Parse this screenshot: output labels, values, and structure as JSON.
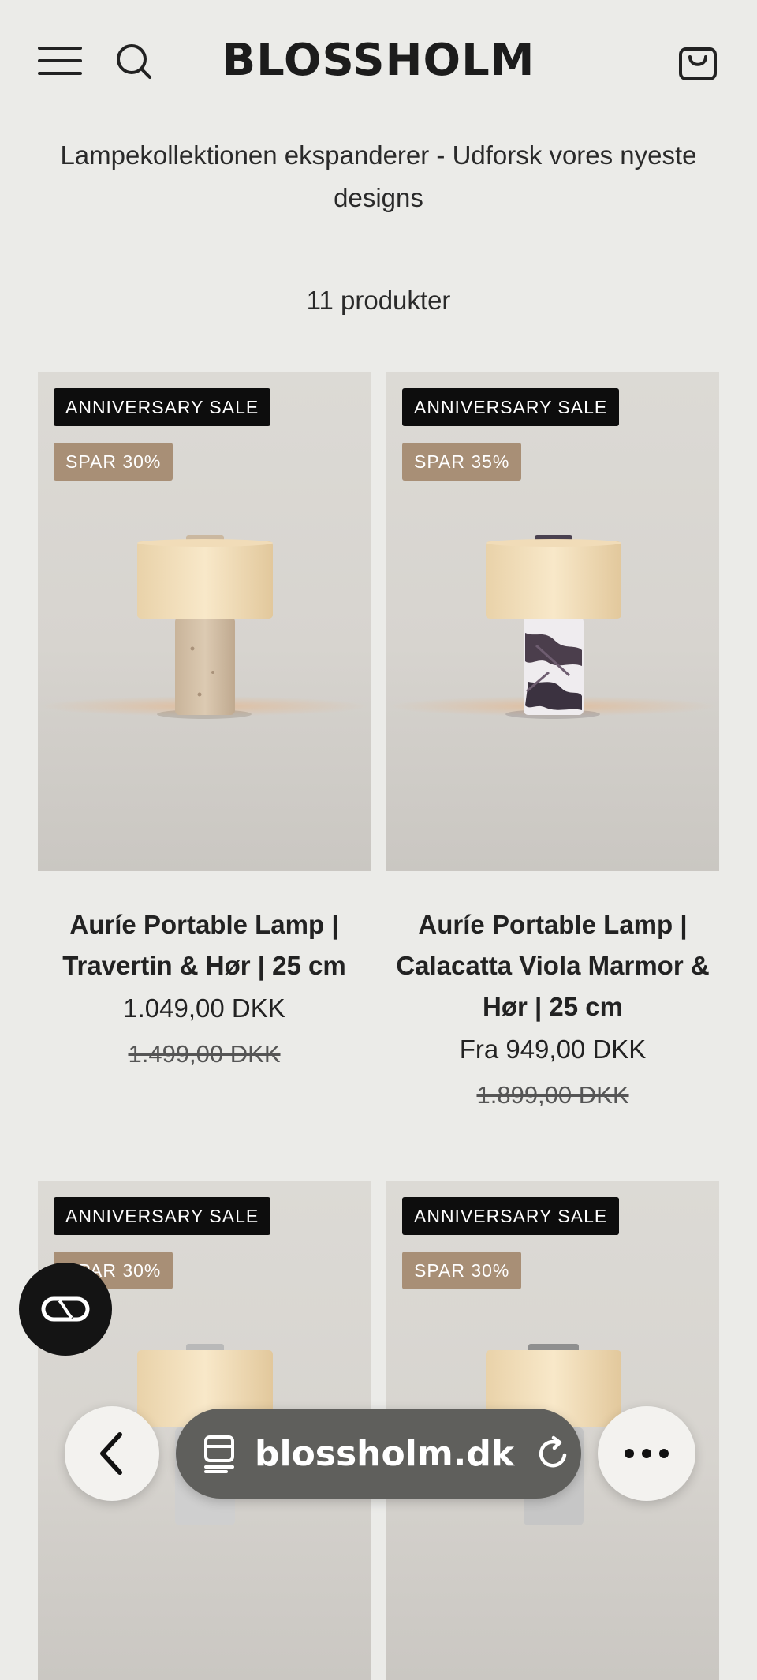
{
  "header": {
    "brand": "BLOSSHOLM",
    "menu_icon": "hamburger-icon",
    "search_icon": "search-icon",
    "cart_icon": "shopping-bag-icon"
  },
  "banner": {
    "text": "Lampekollektionen ekspanderer - Udforsk vores nyeste designs"
  },
  "collection": {
    "count": "11 produkter"
  },
  "products": [
    {
      "sale_badge": "ANNIVERSARY SALE",
      "save_badge": "SPAR 30%",
      "title": "Auríe Portable Lamp | Travertin & Hør | 25 cm",
      "price": "1.049,00 DKK",
      "old_price": "1.499,00 DKK",
      "base": "travertine"
    },
    {
      "sale_badge": "ANNIVERSARY SALE",
      "save_badge": "SPAR 35%",
      "title": "Auríe Portable Lamp | Calacatta Viola Marmor & Hør | 25 cm",
      "price": "Fra 949,00 DKK",
      "old_price": "1.899,00 DKK",
      "base": "marble"
    },
    {
      "sale_badge": "ANNIVERSARY SALE",
      "save_badge": "SPAR 30%",
      "base": "aluminium"
    },
    {
      "sale_badge": "ANNIVERSARY SALE",
      "save_badge": "SPAR 30%",
      "base": "steel"
    }
  ],
  "browser": {
    "url": "blossholm.dk",
    "back_icon": "chevron-left-icon",
    "tabs_icon": "tabs-icon",
    "reload_icon": "reload-icon",
    "more_icon": "more-dots-icon",
    "loop_icon": "loop-icon"
  },
  "colors": {
    "background": "#ebebe8",
    "sale_badge": "#0d0d0d",
    "save_badge": "#a88f76",
    "url_pill": "#5f5f5c"
  }
}
